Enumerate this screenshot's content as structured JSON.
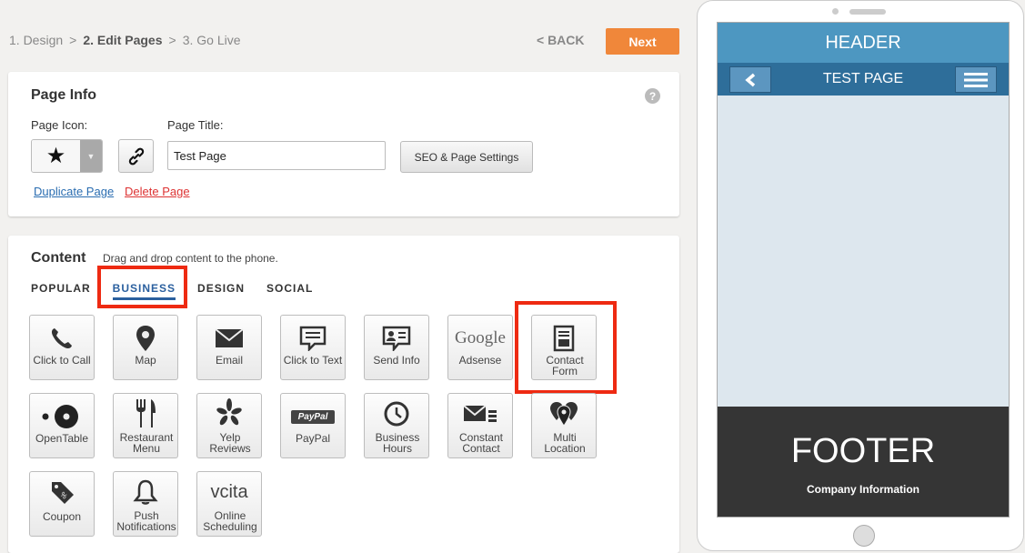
{
  "steps": {
    "step1": "1. Design",
    "step2": "2. Edit Pages",
    "step3": "3. Go Live",
    "separator": ">"
  },
  "nav": {
    "back_label": "< BACK",
    "next_label": "Next"
  },
  "page_info": {
    "title": "Page Info",
    "help_glyph": "?",
    "page_icon_label": "Page Icon:",
    "page_title_label": "Page Title:",
    "page_title_value": "Test Page",
    "seo_button": "SEO & Page Settings",
    "duplicate_link": "Duplicate Page",
    "delete_link": "Delete Page"
  },
  "content": {
    "title": "Content",
    "subtitle": "Drag and drop content to the phone.",
    "tabs": [
      "POPULAR",
      "BUSINESS",
      "DESIGN",
      "SOCIAL"
    ],
    "active_tab": "BUSINESS",
    "tiles": [
      {
        "label": "Click to Call",
        "icon": "phone-icon"
      },
      {
        "label": "Map",
        "icon": "map-pin-icon"
      },
      {
        "label": "Email",
        "icon": "envelope-icon"
      },
      {
        "label": "Click to Text",
        "icon": "speech-bubble-icon"
      },
      {
        "label": "Send Info",
        "icon": "contact-card-icon"
      },
      {
        "label": "Adsense",
        "icon": "google-logo",
        "logo_text": "Google"
      },
      {
        "label": "Contact Form",
        "icon": "form-icon"
      },
      {
        "label": "OpenTable",
        "icon": "opentable-icon"
      },
      {
        "label": "Restaurant Menu",
        "icon": "fork-knife-icon"
      },
      {
        "label": "Yelp Reviews",
        "icon": "yelp-icon"
      },
      {
        "label": "PayPal",
        "icon": "paypal-logo",
        "logo_text": "PayPal"
      },
      {
        "label": "Business Hours",
        "icon": "clock-icon"
      },
      {
        "label": "Constant Contact",
        "icon": "mail-stack-icon"
      },
      {
        "label": "Multi Location",
        "icon": "multi-pin-icon"
      },
      {
        "label": "Coupon",
        "icon": "coupon-tag-icon"
      },
      {
        "label": "Push Notifications",
        "icon": "bell-icon"
      },
      {
        "label": "Online Scheduling",
        "icon": "vcita-logo",
        "logo_text": "vcita"
      }
    ]
  },
  "phone": {
    "header": "HEADER",
    "nav_title": "TEST PAGE",
    "footer_title": "FOOTER",
    "footer_subtitle": "Company Information"
  },
  "colors": {
    "accent_orange": "#f0873a",
    "highlight_red": "#ee2a12",
    "active_tab_blue": "#2a5f9e",
    "phone_header": "#4d97c1",
    "phone_nav": "#2e6e9a",
    "phone_footer": "#353535"
  }
}
